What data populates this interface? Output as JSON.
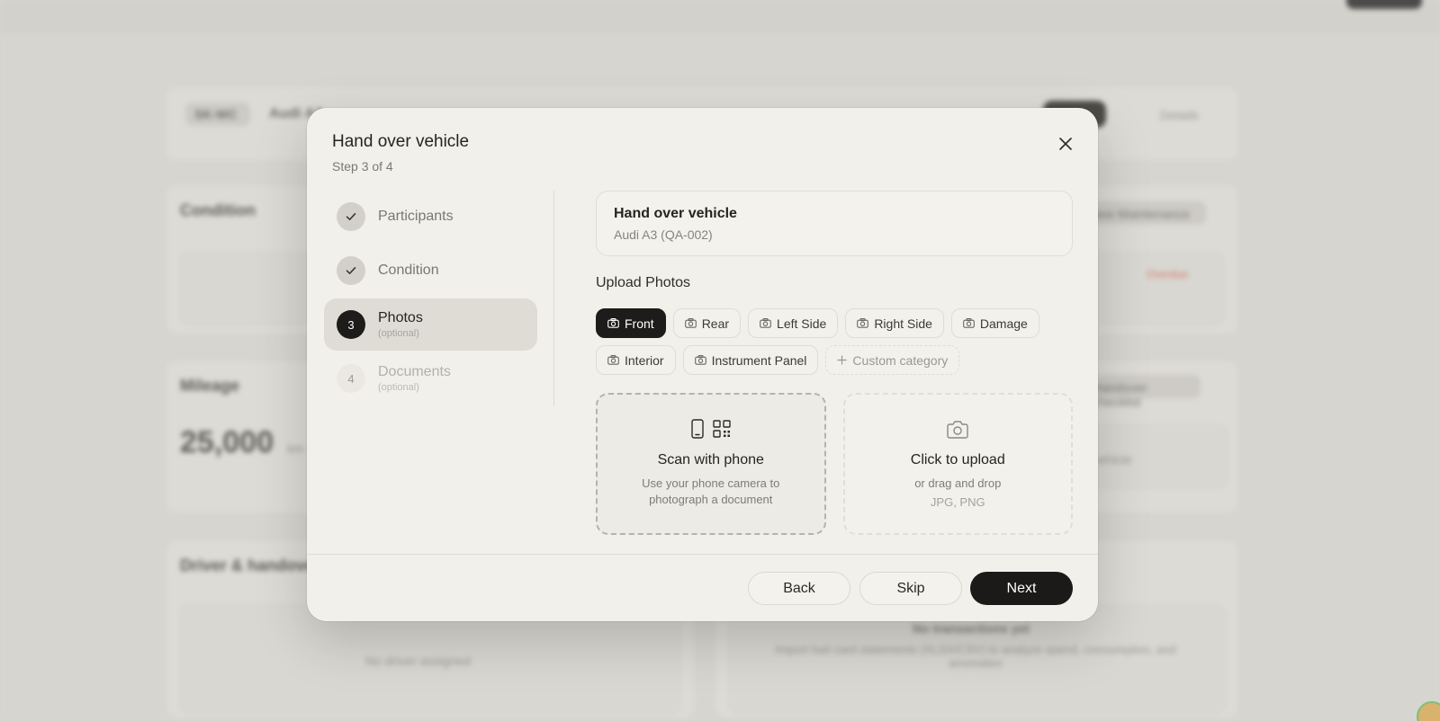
{
  "background": {
    "plate_label": "SK-WC",
    "vehicle_label": "Audi A3",
    "cards": {
      "condition_title": "Condition",
      "maintenance_button": "New Maintenance",
      "status_tag": "Overdue",
      "mileage_title": "Mileage",
      "mileage_value": "25,000",
      "mileage_unit": "km",
      "checklist_button": "Handover checklist",
      "vehicle_note": "vehicle",
      "driver_title": "Driver & handover",
      "no_driver": "No driver assigned",
      "no_transactions": "No transactions yet",
      "transactions_note": "Import fuel card statements (XLSX/CSV) to analyze spend, consumption, and anomalies",
      "details_dropdown": "Details"
    }
  },
  "modal": {
    "title": "Hand over vehicle",
    "step_indicator": "Step 3 of 4",
    "close_icon": "close-icon",
    "steps": [
      {
        "label": "Participants",
        "state": "done",
        "icon": "check-icon"
      },
      {
        "label": "Condition",
        "state": "done",
        "icon": "check-icon"
      },
      {
        "label": "Photos",
        "note": "(optional)",
        "state": "current",
        "number": "3"
      },
      {
        "label": "Documents",
        "note": "(optional)",
        "state": "todo",
        "number": "4"
      }
    ],
    "vehicle_card": {
      "title": "Hand over vehicle",
      "subtitle": "Audi A3 (QA-002)"
    },
    "upload_section_label": "Upload Photos",
    "categories": [
      {
        "label": "Front",
        "selected": true,
        "icon": "camera-icon"
      },
      {
        "label": "Rear",
        "icon": "camera-icon"
      },
      {
        "label": "Left Side",
        "icon": "camera-icon"
      },
      {
        "label": "Right Side",
        "icon": "camera-icon"
      },
      {
        "label": "Damage",
        "icon": "camera-icon"
      },
      {
        "label": "Interior",
        "icon": "camera-icon"
      },
      {
        "label": "Instrument Panel",
        "icon": "camera-icon"
      },
      {
        "label": "Custom category",
        "icon": "plus-icon"
      }
    ],
    "scan_box": {
      "title": "Scan with phone",
      "description": "Use your phone camera to photograph a document",
      "icons": [
        "phone-icon",
        "qr-code-icon"
      ]
    },
    "upload_box": {
      "title": "Click to upload",
      "description": "or drag and drop",
      "formats": "JPG, PNG",
      "icon": "camera-icon"
    },
    "buttons": {
      "back": "Back",
      "skip": "Skip",
      "next": "Next"
    }
  },
  "colors": {
    "primary": "#1b1a18",
    "modal_bg": "#f2f0ea",
    "page_bg": "#dcdad5",
    "overdue": "#d4604e"
  }
}
